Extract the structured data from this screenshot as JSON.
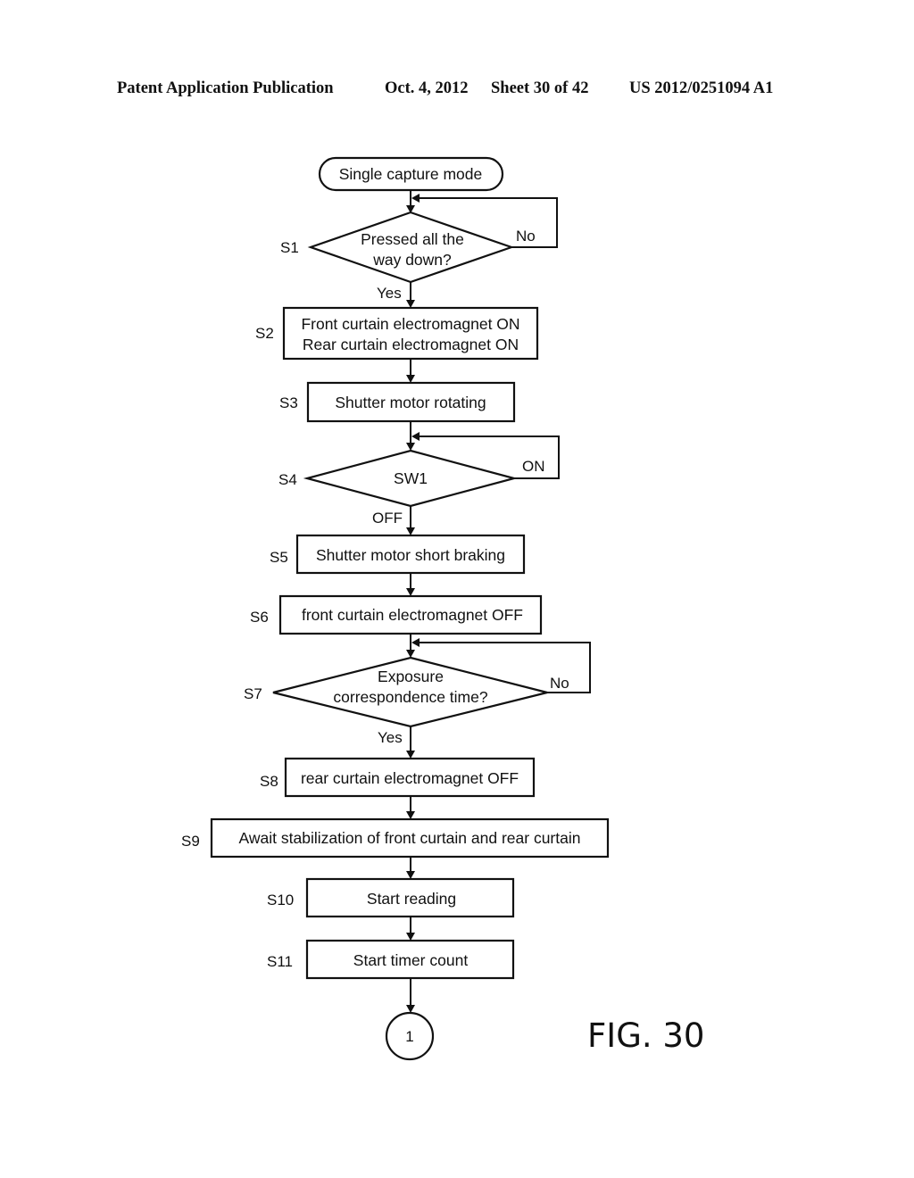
{
  "header": {
    "publication": "Patent Application Publication",
    "date": "Oct. 4, 2012",
    "sheet": "Sheet 30 of 42",
    "number": "US 2012/0251094 A1"
  },
  "flowchart": {
    "start": "Single capture mode",
    "steps": {
      "s1": {
        "id": "S1",
        "line1": "Pressed all the",
        "line2": "way down?",
        "no": "No",
        "yes": "Yes"
      },
      "s2": {
        "id": "S2",
        "line1": "Front curtain electromagnet ON",
        "line2": "Rear curtain electromagnet ON"
      },
      "s3": {
        "id": "S3",
        "text": "Shutter motor rotating"
      },
      "s4": {
        "id": "S4",
        "text": "SW1",
        "on": "ON",
        "off": "OFF"
      },
      "s5": {
        "id": "S5",
        "text": "Shutter motor short braking"
      },
      "s6": {
        "id": "S6",
        "text": "front curtain electromagnet OFF"
      },
      "s7": {
        "id": "S7",
        "line1": "Exposure",
        "line2": "correspondence time?",
        "no": "No",
        "yes": "Yes"
      },
      "s8": {
        "id": "S8",
        "text": "rear curtain electromagnet OFF"
      },
      "s9": {
        "id": "S9",
        "text": "Await stabilization of front curtain and rear curtain"
      },
      "s10": {
        "id": "S10",
        "text": "Start reading"
      },
      "s11": {
        "id": "S11",
        "text": "Start timer count"
      }
    },
    "connector": "1"
  },
  "figure_label": "FIG. 30"
}
